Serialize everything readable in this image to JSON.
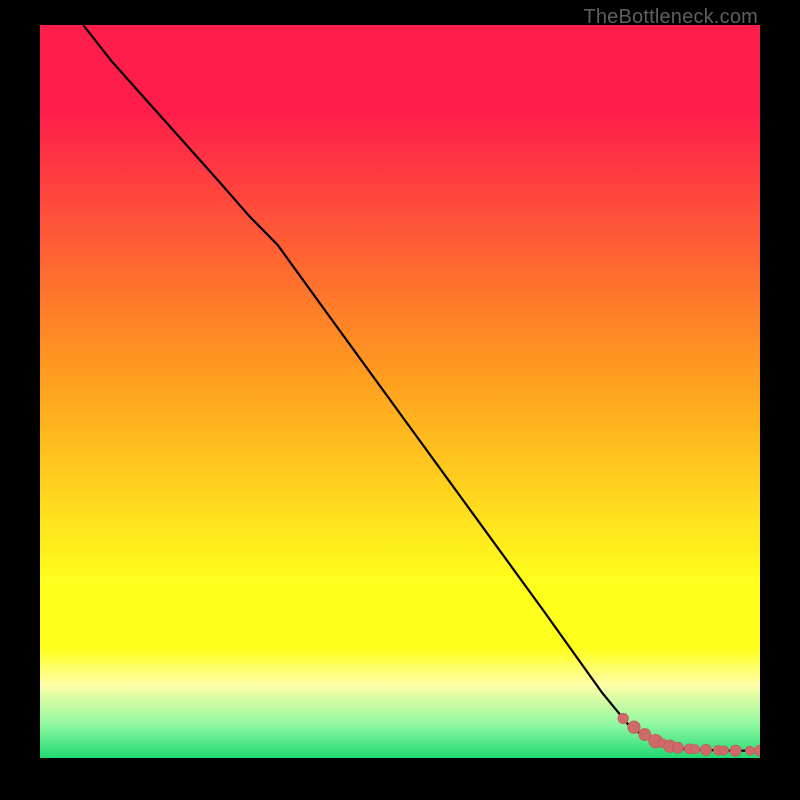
{
  "credit": "TheBottleneck.com",
  "colors": {
    "red": "#ff1e4b",
    "orange": "#ff9a1f",
    "yellow": "#ffff1c",
    "paleYellow": "#ffffa8",
    "lightGreen": "#8ef7a0",
    "green": "#1fd973",
    "curve": "#000000",
    "marker": "#d06a6a",
    "markerStroke": "#c35a5a"
  },
  "chart_data": {
    "type": "line",
    "title": "",
    "xlabel": "",
    "ylabel": "",
    "xlim": [
      0,
      100
    ],
    "ylim": [
      0,
      100
    ],
    "grid": false,
    "legend": false,
    "series": [
      {
        "name": "curve",
        "x": [
          6,
          10,
          15,
          20,
          25,
          29,
          33,
          40,
          50,
          60,
          70,
          78,
          82,
          85,
          87,
          89,
          90,
          92,
          94,
          96,
          98,
          100
        ],
        "y": [
          100,
          95,
          89.5,
          84,
          78.5,
          74,
          70,
          60.5,
          47,
          33.5,
          20,
          9,
          4.2,
          2.3,
          1.6,
          1.3,
          1.2,
          1.1,
          1.05,
          1.0,
          1.0,
          1.0
        ]
      }
    ],
    "markers": {
      "name": "points",
      "x": [
        81,
        82.5,
        84,
        85.5,
        86.5,
        87.5,
        88.6,
        90.2,
        91,
        92.5,
        94.2,
        95,
        96.6,
        98.6,
        100
      ],
      "y": [
        5.4,
        4.2,
        3.2,
        2.3,
        2.0,
        1.6,
        1.4,
        1.25,
        1.2,
        1.1,
        1.05,
        1.03,
        1.0,
        1.0,
        1.0
      ],
      "r": [
        5.2,
        6.2,
        6.0,
        6.8,
        4.5,
        6.2,
        5.5,
        5.0,
        4.5,
        5.5,
        4.8,
        4.5,
        5.5,
        4.5,
        5.5
      ]
    }
  }
}
